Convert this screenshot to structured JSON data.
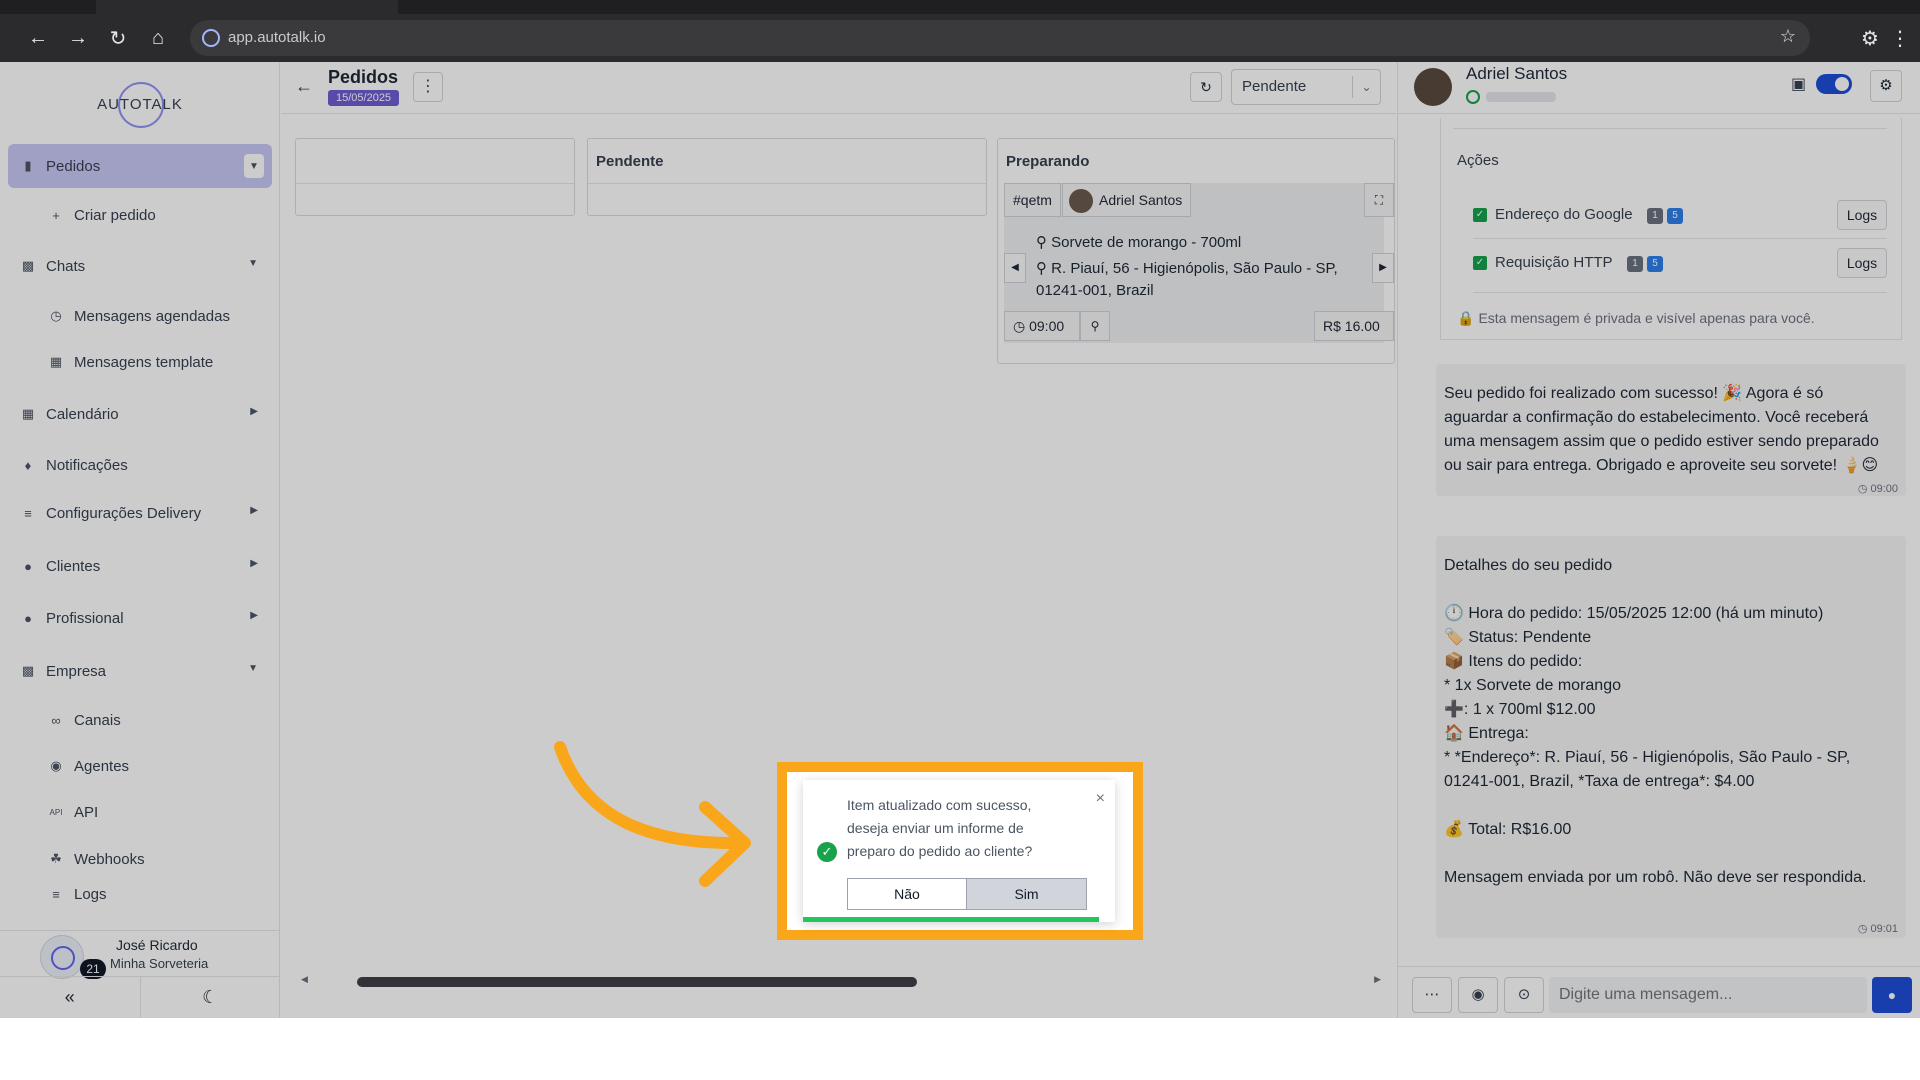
{
  "browser": {
    "url": "app.autotalk.io"
  },
  "sidebar": {
    "logo_text": "AUTOTALK",
    "items": [
      {
        "label": "Pedidos",
        "icon": "clipboard-icon"
      },
      {
        "label": "Criar pedido",
        "icon": "plus-icon"
      },
      {
        "label": "Chats",
        "icon": "chat-icon"
      },
      {
        "label": "Mensagens agendadas",
        "icon": "clock-icon"
      },
      {
        "label": "Mensagens template",
        "icon": "template-icon"
      },
      {
        "label": "Calendário",
        "icon": "calendar-icon"
      },
      {
        "label": "Notificações",
        "icon": "bell-icon"
      },
      {
        "label": "Configurações Delivery",
        "icon": "sliders-icon"
      },
      {
        "label": "Clientes",
        "icon": "users-icon"
      },
      {
        "label": "Profissional",
        "icon": "user-cog-icon"
      },
      {
        "label": "Empresa",
        "icon": "building-icon"
      },
      {
        "label": "Canais",
        "icon": "link-icon"
      },
      {
        "label": "Agentes",
        "icon": "robot-icon"
      },
      {
        "label": "API",
        "icon": "api-icon"
      },
      {
        "label": "Webhooks",
        "icon": "webhook-icon"
      },
      {
        "label": "Logs",
        "icon": "list-icon"
      }
    ],
    "user": {
      "name": "José Ricardo",
      "company": "Minha Sorveteria",
      "badge": "21"
    }
  },
  "main": {
    "title": "Pedidos",
    "date": "15/05/2025",
    "status_filter": "Pendente",
    "columns": [
      {
        "title": ""
      },
      {
        "title": "Pendente"
      },
      {
        "title": "Preparando"
      }
    ],
    "card": {
      "tag": "#qetm",
      "customer": "Adriel Santos",
      "item": "Sorvete de morango - 700ml",
      "address_line1": "R. Piauí, 56 - Higienópolis, São Paulo - SP,",
      "address_line2": "01241-001, Brazil",
      "time": "09:00",
      "price": "R$ 16.00"
    }
  },
  "chat": {
    "contact_name": "Adriel Santos",
    "actions_title": "Ações",
    "actions": [
      {
        "label": "Endereço do Google",
        "b1": "1",
        "b2": "5",
        "logs": "Logs"
      },
      {
        "label": "Requisição HTTP",
        "b1": "1",
        "b2": "5",
        "logs": "Logs"
      }
    ],
    "privacy_note": "Esta mensagem é privada e visível apenas para você.",
    "messages": [
      {
        "lines": [
          "Seu pedido foi realizado com sucesso! 🎉 Agora é só",
          "aguardar a confirmação do estabelecimento. Você receberá",
          "uma mensagem assim que o pedido estiver sendo preparado",
          "ou sair para entrega. Obrigado e aproveite seu sorvete! 🍦😊"
        ],
        "time": "09:00"
      },
      {
        "lines": [
          "Detalhes do seu pedido",
          "",
          "🕛 Hora do pedido: 15/05/2025 12:00 (há um minuto)",
          "🏷️ Status: Pendente",
          "📦 Itens do pedido:",
          "* 1x Sorvete de morango",
          "➕: 1 x 700ml $12.00",
          "🏠 Entrega:",
          "* *Endereço*: R. Piauí, 56 - Higienópolis, São Paulo - SP,",
          "01241-001, Brazil, *Taxa de entrega*: $4.00",
          "",
          "💰 Total: R$16.00",
          "",
          "Mensagem enviada por um robô. Não deve ser respondida."
        ],
        "time": "09:01"
      }
    ],
    "composer_placeholder": "Digite uma mensagem..."
  },
  "toast": {
    "message": "Item atualizado com sucesso, deseja enviar um informe de preparo do pedido ao cliente?",
    "no": "Não",
    "yes": "Sim",
    "progress": 0.95
  },
  "colors": {
    "accent": "#6d5dd3",
    "highlight": "#f9a61a",
    "success": "#16a34a",
    "primary_blue": "#1d4ed8"
  }
}
